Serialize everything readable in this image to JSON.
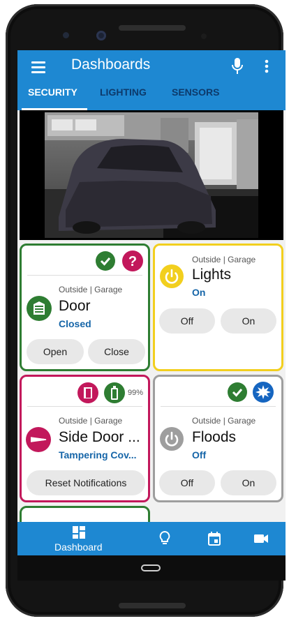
{
  "header": {
    "title": "Dashboards"
  },
  "tabs": [
    {
      "label": "SECURITY"
    },
    {
      "label": "LIGHTING"
    },
    {
      "label": "SENSORS"
    }
  ],
  "cards": {
    "door": {
      "location": "Outside | Garage",
      "name": "Door",
      "state": "Closed",
      "buttons": [
        "Open",
        "Close"
      ],
      "color": "#2e7d32"
    },
    "lights": {
      "location": "Outside | Garage",
      "name": "Lights",
      "state": "On",
      "buttons": [
        "Off",
        "On"
      ],
      "color": "#f2cf1e"
    },
    "side_door": {
      "location": "Outside | Garage",
      "name": "Side Door ...",
      "state": "Tampering Cov...",
      "battery": "99%",
      "button": "Reset Notifications",
      "color": "#c2185b"
    },
    "floods": {
      "location": "Outside | Garage",
      "name": "Floods",
      "state": "Off",
      "buttons": [
        "Off",
        "On"
      ],
      "color": "#9e9e9e"
    }
  },
  "bottom_nav": {
    "dashboard_label": "Dashboard"
  },
  "colors": {
    "primary": "#1e88d2",
    "ok": "#2e7d32",
    "alert": "#c2185b",
    "warning": "#f2cf1e",
    "link": "#1565a8"
  }
}
